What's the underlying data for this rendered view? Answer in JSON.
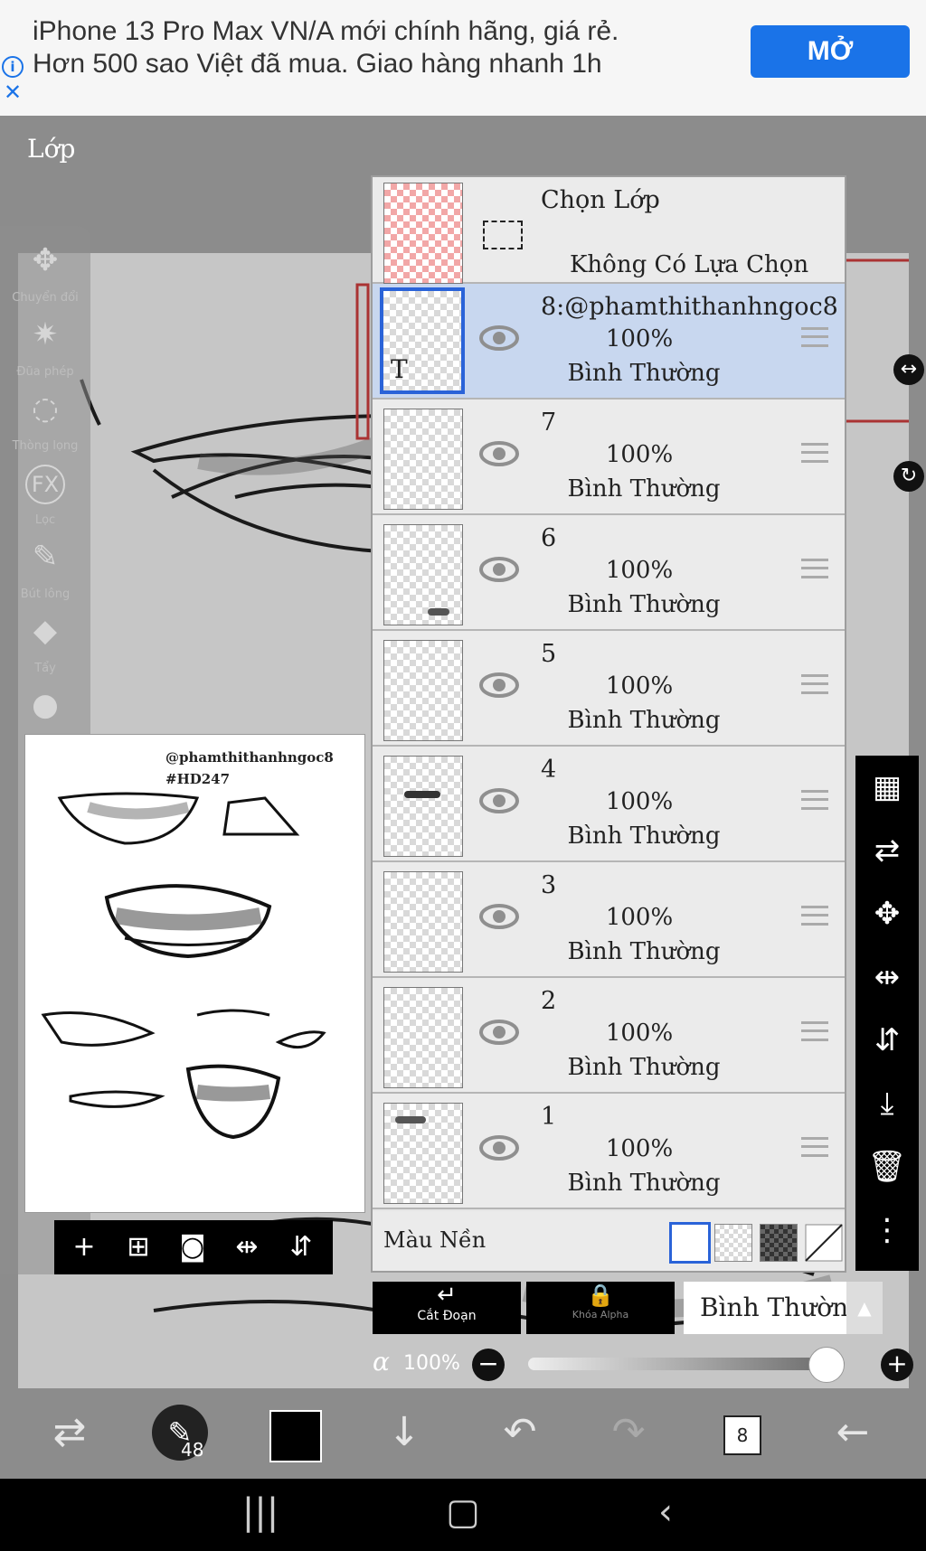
{
  "ad": {
    "line1": "iPhone 13 Pro Max VN/A mới chính hãng, giá rẻ.",
    "line2": "Hơn 500 sao Việt đã mua. Giao hàng nhanh 1h",
    "info_icon": "info-icon",
    "close_icon": "close-icon",
    "button": "MỞ"
  },
  "screen_title": "Lớp",
  "tools": [
    {
      "icon": "move-icon",
      "label": "Chuyển đổi"
    },
    {
      "icon": "magic-wand-icon",
      "label": "Đũa phép"
    },
    {
      "icon": "lasso-icon",
      "label": "Thòng lọng"
    },
    {
      "icon": "fx-icon",
      "label": "Lọc"
    },
    {
      "icon": "brush-icon",
      "label": "Bút lông"
    },
    {
      "icon": "eraser-icon",
      "label": "Tẩy"
    }
  ],
  "preview": {
    "watermark_user": "@phamthithanhngoc8",
    "watermark_tag": "#HD247"
  },
  "selection_row": {
    "title": "Chọn Lớp",
    "status": "Không Có Lựa Chọn"
  },
  "layers": [
    {
      "name": "8:@phamthithanhngoc8",
      "opacity": "100%",
      "blend": "Bình Thường",
      "selected": true,
      "thumb_text": "T"
    },
    {
      "name": "7",
      "opacity": "100%",
      "blend": "Bình Thường",
      "selected": false,
      "thumb_text": ""
    },
    {
      "name": "6",
      "opacity": "100%",
      "blend": "Bình Thường",
      "selected": false,
      "thumb_text": ""
    },
    {
      "name": "5",
      "opacity": "100%",
      "blend": "Bình Thường",
      "selected": false,
      "thumb_text": ""
    },
    {
      "name": "4",
      "opacity": "100%",
      "blend": "Bình Thường",
      "selected": false,
      "thumb_text": ""
    },
    {
      "name": "3",
      "opacity": "100%",
      "blend": "Bình Thường",
      "selected": false,
      "thumb_text": ""
    },
    {
      "name": "2",
      "opacity": "100%",
      "blend": "Bình Thường",
      "selected": false,
      "thumb_text": ""
    },
    {
      "name": "1",
      "opacity": "100%",
      "blend": "Bình Thường",
      "selected": false,
      "thumb_text": ""
    }
  ],
  "background_label": "Màu Nền",
  "clip_label": "Cắt Đoạn",
  "alpha_lock_label": "Khóa Alpha",
  "blend_mode": "Bình Thường",
  "alpha_label": "α",
  "alpha_value": "100%",
  "alpha_fraction": 1.0,
  "brush_size": "48",
  "layer_count": "8",
  "colors": {
    "accent": "#2a63d8",
    "selected_row": "#c8d7ef",
    "ad_button": "#1a73e8",
    "current_color": "#000000"
  }
}
